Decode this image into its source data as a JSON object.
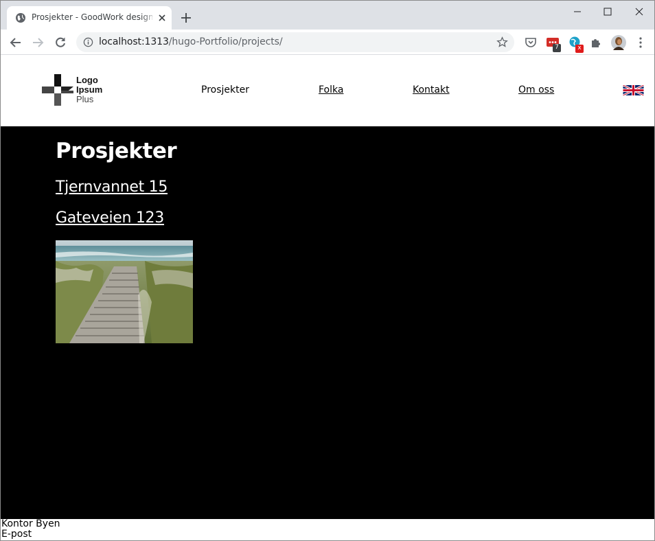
{
  "browser": {
    "tab_title": "Prosjekter - GoodWork designere",
    "url_host": "localhost:1313",
    "url_path": "/hugo-Portfolio/projects/",
    "extension_badge_count": "7",
    "extension_badge_x": "x"
  },
  "site": {
    "logo": {
      "line1": "Logo",
      "line2": "Ipsum",
      "line3": "Plus"
    },
    "nav": [
      {
        "label": "Prosjekter",
        "active": true
      },
      {
        "label": "Folka",
        "active": false
      },
      {
        "label": "Kontakt",
        "active": false
      },
      {
        "label": "Om oss",
        "active": false
      }
    ],
    "language_flag": "uk-flag-icon"
  },
  "main": {
    "title": "Prosjekter",
    "projects": [
      {
        "name": "Tjernvannet 15"
      },
      {
        "name": "Gateveien 123"
      }
    ],
    "thumbnail": "boardwalk-beach-image"
  },
  "footer": {
    "line1": "Kontor Byen",
    "line2": "E-post"
  },
  "colors": {
    "main_bg": "#000000",
    "chrome_bg": "#dee1e6",
    "omnibox_bg": "#f1f3f4"
  }
}
